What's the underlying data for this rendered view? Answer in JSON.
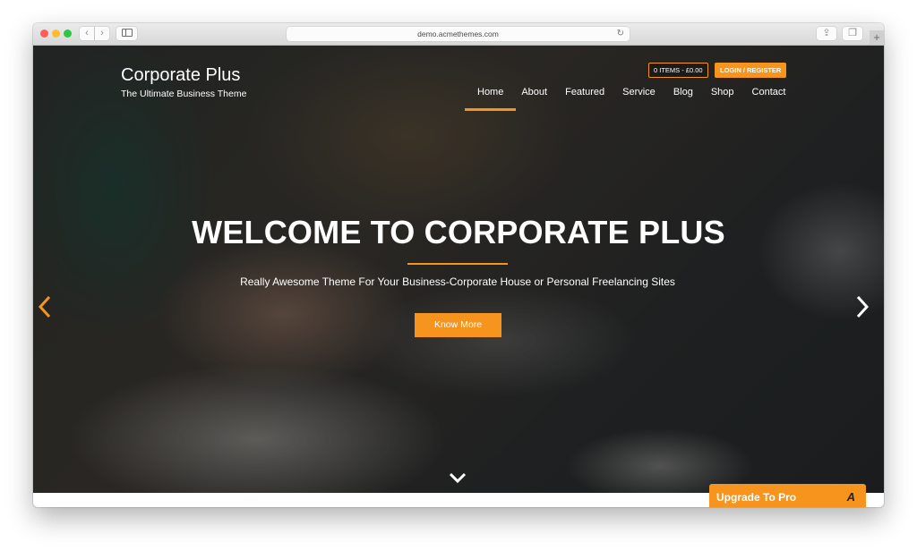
{
  "browser": {
    "url": "demo.acmethemes.com",
    "icons": {
      "back": "chevron-left-icon",
      "forward": "chevron-right-icon",
      "sidebar": "sidebar-icon",
      "reload": "reload-icon",
      "share": "share-icon",
      "tabs": "tabs-icon",
      "new_tab": "plus-icon"
    },
    "glyphs": {
      "back": "‹",
      "forward": "›",
      "reload": "↻",
      "share": "⇪",
      "tabs": "❐",
      "new_tab": "+"
    }
  },
  "site": {
    "title": "Corporate Plus",
    "tagline": "The Ultimate Business Theme"
  },
  "header": {
    "cart_label": "0 ITEMS - £0.00",
    "login_label": "LOGIN / REGISTER"
  },
  "nav": {
    "items": [
      {
        "label": "Home",
        "active": true
      },
      {
        "label": "About",
        "active": false
      },
      {
        "label": "Featured",
        "active": false
      },
      {
        "label": "Service",
        "active": false
      },
      {
        "label": "Blog",
        "active": false
      },
      {
        "label": "Shop",
        "active": false
      },
      {
        "label": "Contact",
        "active": false
      }
    ]
  },
  "hero": {
    "title": "WELCOME TO CORPORATE PLUS",
    "subtitle": "Really Awesome Theme For Your Business-Corporate House or Personal Freelancing Sites",
    "button_label": "Know More",
    "prev_glyph": "‹",
    "next_glyph": "›"
  },
  "upgrade": {
    "label": "Upgrade To Pro",
    "icon_glyph": "A"
  },
  "colors": {
    "accent": "#f7941d"
  }
}
